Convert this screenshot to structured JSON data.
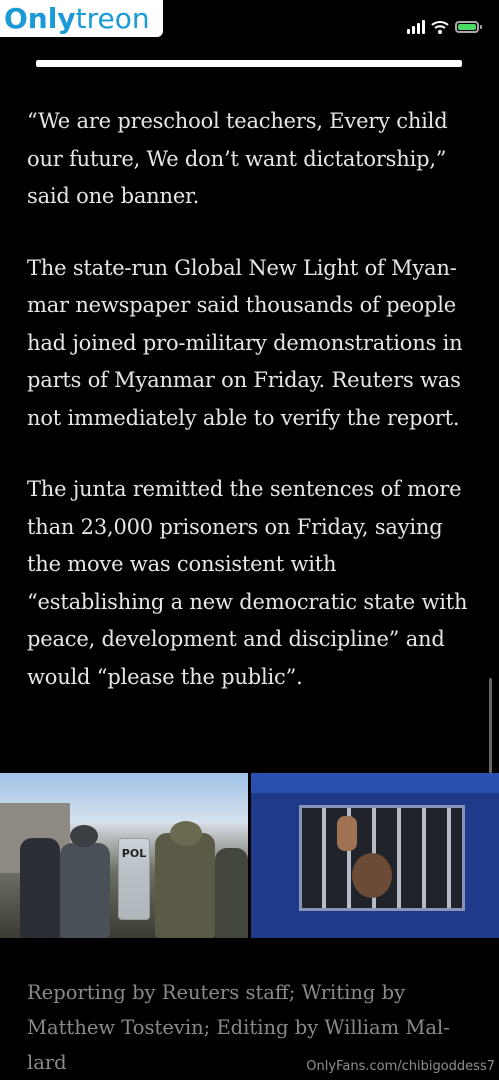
{
  "watermark_logo": {
    "part1": "Only",
    "part2": "treon"
  },
  "article": {
    "paragraphs": [
      "“We are preschool teachers, Every child our future, We don’t want dictatorship,” said one banner.",
      "The state-run Global New Light of Myan­mar newspaper said thousands of people had joined pro-military demonstrations in parts of Myanmar on Friday. Reuters was not immediately able to verify the report.",
      "The junta remitted the sentences of more than 23,000 prisoners on Friday, saying the move was consistent with “establishing a new democratic state with peace, devel­opment and discipline” and would “please the public”."
    ],
    "credit": "Reporting by Reuters staff; Writing by Matthew Tostevin; Editing by William Mal­lard"
  },
  "photo_left": {
    "shield_text": "POL"
  },
  "watermark_url": "OnlyFans.com/chibigoddess7",
  "colors": {
    "background": "#000000",
    "text": "#e6e6e6",
    "credit": "#8a8a8a",
    "brand": "#1a9bd7"
  },
  "icons": [
    "signal-icon",
    "wifi-icon",
    "battery-icon"
  ]
}
